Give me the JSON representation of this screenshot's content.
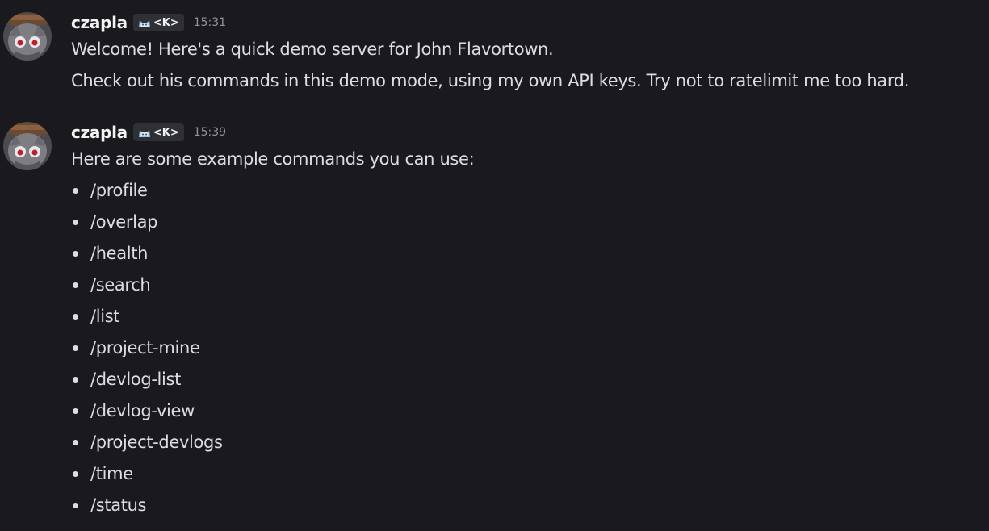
{
  "messages": [
    {
      "username": "czapla",
      "tag": "<K>",
      "timestamp": "15:31",
      "lines": [
        "Welcome! Here's a quick demo server for John Flavortown.",
        "Check out his commands in this demo mode, using my own API keys. Try not to ratelimit me too hard."
      ]
    },
    {
      "username": "czapla",
      "tag": "<K>",
      "timestamp": "15:39",
      "intro": "Here are some example commands you can use:",
      "commands": [
        "/profile",
        "/overlap",
        "/health",
        "/search",
        "/list",
        "/project-mine",
        "/devlog-list",
        "/devlog-view",
        "/project-devlogs",
        "/time",
        "/status"
      ]
    }
  ],
  "colors": {
    "background": "#1a1a1e",
    "text": "#dbdee1",
    "username": "#f2f3f5",
    "timestamp": "#92949b",
    "tag_background": "#2e3036"
  },
  "icons": {
    "avatar": "user-avatar",
    "tag": "cat-tag-icon"
  }
}
